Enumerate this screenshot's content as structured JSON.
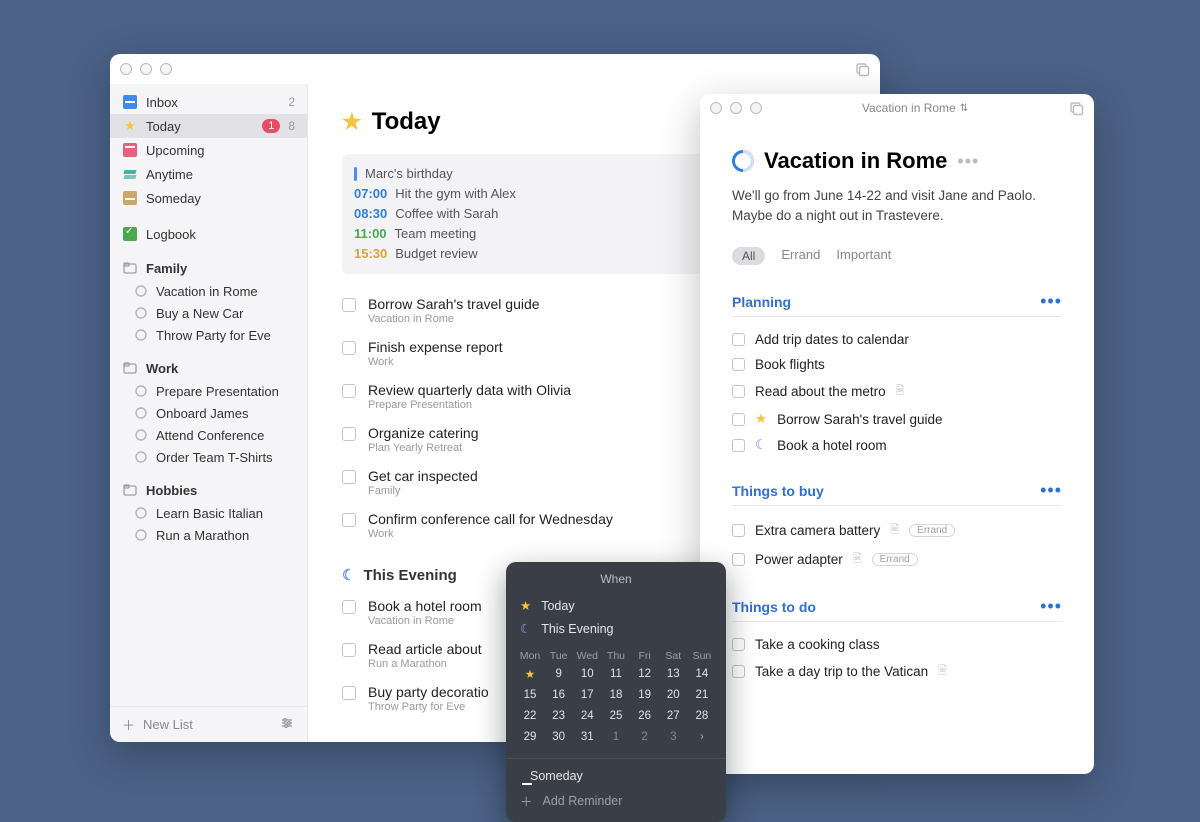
{
  "sidebar": {
    "inbox": {
      "label": "Inbox",
      "count": "2"
    },
    "today": {
      "label": "Today",
      "badge": "1",
      "count": "8"
    },
    "upcoming": {
      "label": "Upcoming"
    },
    "anytime": {
      "label": "Anytime"
    },
    "someday": {
      "label": "Someday"
    },
    "logbook": {
      "label": "Logbook"
    },
    "areas": [
      {
        "name": "Family",
        "projects": [
          "Vacation in Rome",
          "Buy a New Car",
          "Throw Party for Eve"
        ]
      },
      {
        "name": "Work",
        "projects": [
          "Prepare Presentation",
          "Onboard James",
          "Attend Conference",
          "Order Team T-Shirts"
        ]
      },
      {
        "name": "Hobbies",
        "projects": [
          "Learn Basic Italian",
          "Run a Marathon"
        ]
      }
    ],
    "footer": {
      "new_list": "New List"
    }
  },
  "content": {
    "title": "Today",
    "schedule": [
      {
        "time": "",
        "text": "Marc's birthday"
      },
      {
        "time": "07:00",
        "text": "Hit the gym with Alex"
      },
      {
        "time": "08:30",
        "text": "Coffee with Sarah"
      },
      {
        "time": "11:00",
        "text": "Team meeting"
      },
      {
        "time": "15:30",
        "text": "Budget review"
      }
    ],
    "tasks": [
      {
        "title": "Borrow Sarah's travel guide",
        "sub": "Vacation in Rome"
      },
      {
        "title": "Finish expense report",
        "sub": "Work"
      },
      {
        "title": "Review quarterly data with Olivia",
        "sub": "Prepare Presentation"
      },
      {
        "title": "Organize catering",
        "sub": "Plan Yearly Retreat"
      },
      {
        "title": "Get car inspected",
        "sub": "Family"
      },
      {
        "title": "Confirm conference call for Wednesday",
        "sub": "Work"
      }
    ],
    "evening_h": "This Evening",
    "evening": [
      {
        "title": "Book a hotel room",
        "sub": "Vacation in Rome"
      },
      {
        "title": "Read article about",
        "sub": "Run a Marathon"
      },
      {
        "title": "Buy party decoratio",
        "sub": "Throw Party for Eve"
      }
    ]
  },
  "project": {
    "window_title": "Vacation in Rome",
    "title": "Vacation in Rome",
    "desc": "We'll go from June 14-22 and visit Jane and Paolo. Maybe do a night out in Trastevere.",
    "tags": {
      "all": "All",
      "errand": "Errand",
      "important": "Important"
    },
    "sections": [
      {
        "name": "Planning",
        "tasks": [
          {
            "text": "Add trip dates to calendar"
          },
          {
            "text": "Book flights"
          },
          {
            "text": "Read about the metro",
            "file": true
          },
          {
            "text": "Borrow Sarah's travel guide",
            "star": true
          },
          {
            "text": "Book a hotel room",
            "moon": true
          }
        ]
      },
      {
        "name": "Things to buy",
        "tasks": [
          {
            "text": "Extra camera battery",
            "file": true,
            "tag": "Errand"
          },
          {
            "text": "Power adapter",
            "file": true,
            "tag": "Errand"
          }
        ]
      },
      {
        "name": "Things to do",
        "tasks": [
          {
            "text": "Take a cooking class"
          },
          {
            "text": "Take a day trip to the Vatican",
            "file": true
          }
        ]
      }
    ]
  },
  "popover": {
    "title": "When",
    "today": "Today",
    "evening": "This Evening",
    "days": [
      "Mon",
      "Tue",
      "Wed",
      "Thu",
      "Fri",
      "Sat",
      "Sun"
    ],
    "rows": [
      [
        "★",
        "9",
        "10",
        "11",
        "12",
        "13",
        "14"
      ],
      [
        "15",
        "16",
        "17",
        "18",
        "19",
        "20",
        "21"
      ],
      [
        "22",
        "23",
        "24",
        "25",
        "26",
        "27",
        "28"
      ],
      [
        "29",
        "30",
        "31",
        "1",
        "2",
        "3",
        "›"
      ]
    ],
    "someday": "Someday",
    "reminder": "Add Reminder"
  }
}
